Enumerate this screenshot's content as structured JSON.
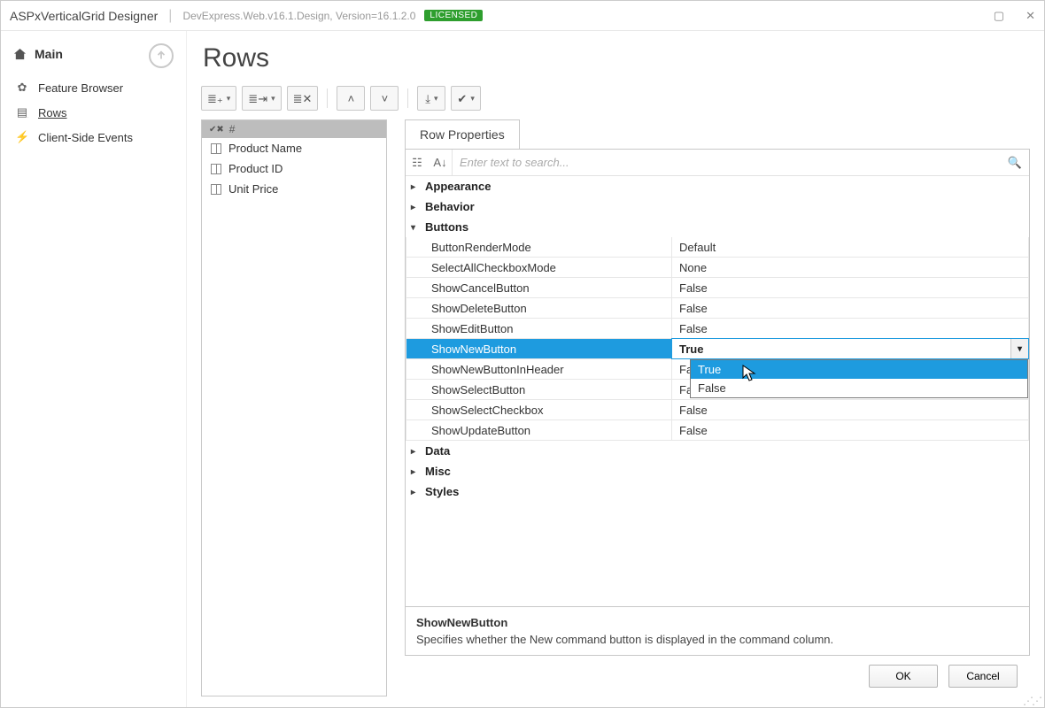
{
  "header": {
    "app_name": "ASPxVerticalGrid Designer",
    "version_line": "DevExpress.Web.v16.1.Design, Version=16.1.2.0",
    "license_badge": "LICENSED"
  },
  "sidebar": {
    "main_label": "Main",
    "items": [
      {
        "label": "Feature Browser"
      },
      {
        "label": "Rows"
      },
      {
        "label": "Client-Side Events"
      }
    ]
  },
  "page": {
    "title": "Rows"
  },
  "rows_list": {
    "header_symbol": "#",
    "items": [
      {
        "label": "Product Name"
      },
      {
        "label": "Product ID"
      },
      {
        "label": "Unit Price"
      }
    ]
  },
  "props": {
    "tab_label": "Row Properties",
    "search_placeholder": "Enter text to search...",
    "categories": {
      "appearance": "Appearance",
      "behavior": "Behavior",
      "buttons": "Buttons",
      "data": "Data",
      "misc": "Misc",
      "styles": "Styles"
    },
    "buttons_rows": [
      {
        "key": "ButtonRenderMode",
        "value": "Default"
      },
      {
        "key": "SelectAllCheckboxMode",
        "value": "None"
      },
      {
        "key": "ShowCancelButton",
        "value": "False"
      },
      {
        "key": "ShowDeleteButton",
        "value": "False"
      },
      {
        "key": "ShowEditButton",
        "value": "False"
      },
      {
        "key": "ShowNewButton",
        "value": "True"
      },
      {
        "key": "ShowNewButtonInHeader",
        "value": "False"
      },
      {
        "key": "ShowSelectButton",
        "value": "False"
      },
      {
        "key": "ShowSelectCheckbox",
        "value": "False"
      },
      {
        "key": "ShowUpdateButton",
        "value": "False"
      }
    ],
    "dropdown_options": [
      "True",
      "False"
    ],
    "selected_row_index": 5,
    "description": {
      "title": "ShowNewButton",
      "text": "Specifies whether the New command button is displayed in the command column."
    }
  },
  "footer": {
    "ok": "OK",
    "cancel": "Cancel"
  }
}
